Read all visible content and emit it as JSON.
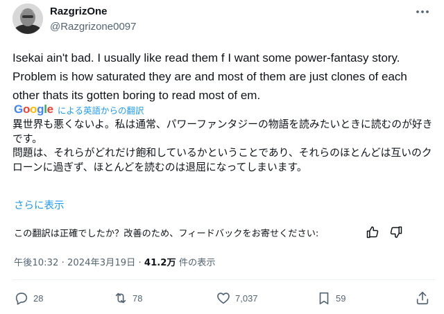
{
  "author": {
    "display_name": "RazgrizOne",
    "handle": "@Razgrizone0097"
  },
  "post": {
    "text": "Isekai ain't bad.  I usually like read them f I want some power-fantasy story. Problem is how saturated they are and most of them are just clones of each other thats its gotten boring to read most of em."
  },
  "translation": {
    "provider_logo_text": "Google",
    "provider_label": "による英語からの翻訳",
    "text_line1": "異世界も悪くないよ。私は通常、パワーファンタジーの物語を読みたいときに読むのが好きです。",
    "text_line2": "問題は、それらがどれだけ飽和しているかということであり、それらのほとんどは互いのクローンに過ぎず、ほとんどを読むのは退屈になってしまいます。",
    "show_more": "さらに表示",
    "feedback_prompt": "この翻訳は正確でしたか？改善のため、フィードバックをお寄せください:"
  },
  "meta": {
    "time": "午後10:32",
    "separator": "·",
    "date": "2024年3月19日",
    "views_count": "41.2万",
    "views_label": "件の表示"
  },
  "actions": {
    "replies": "28",
    "reposts": "78",
    "likes": "7,037",
    "bookmarks": "59"
  },
  "icons": {
    "more": "more-dots-icon",
    "thumbs_up": "thumbs-up-icon",
    "thumbs_down": "thumbs-down-icon",
    "reply": "reply-icon",
    "repost": "repost-icon",
    "like": "heart-icon",
    "bookmark": "bookmark-icon",
    "share": "share-icon"
  },
  "colors": {
    "link_blue": "#1d9bf0",
    "secondary_text": "#536471",
    "primary_text": "#0f1419",
    "google_blue": "#4285f4",
    "google_red": "#ea4335",
    "google_yellow": "#fbbc05",
    "google_green": "#34a853"
  }
}
